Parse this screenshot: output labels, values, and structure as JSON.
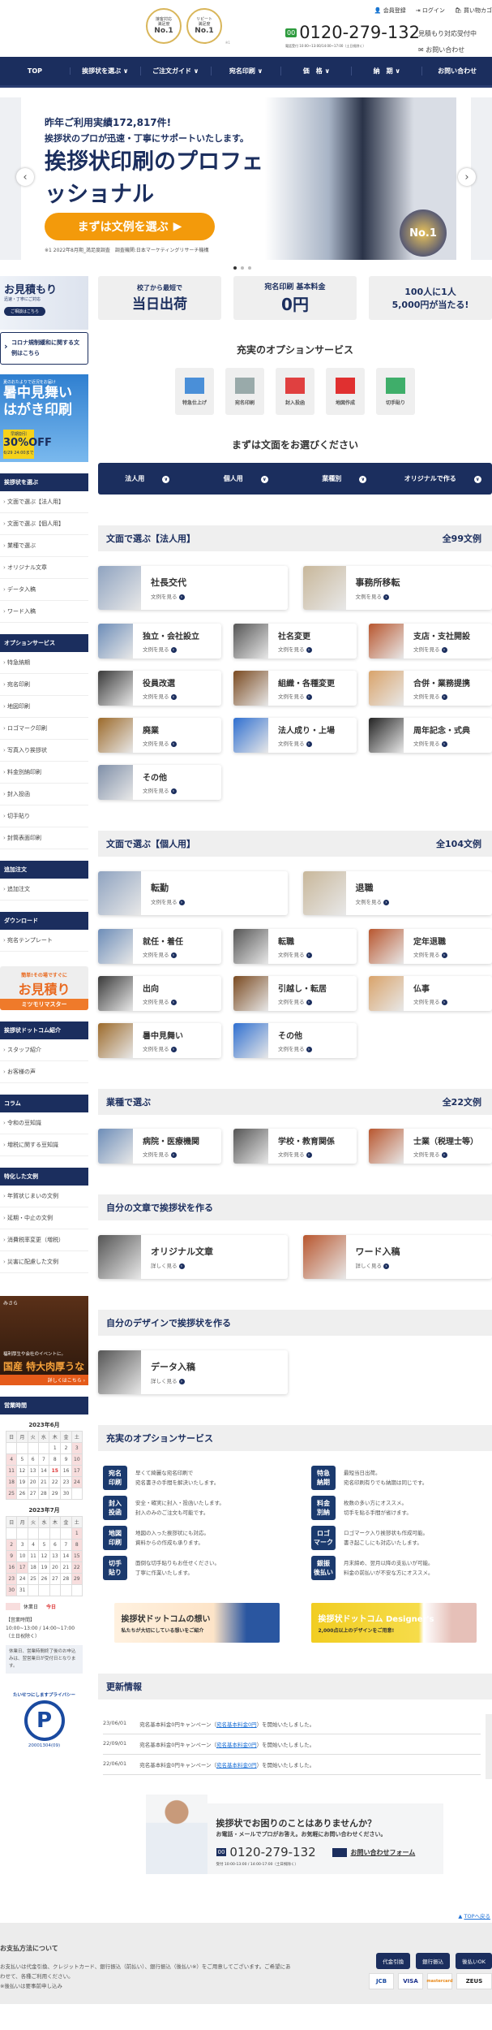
{
  "header": {
    "badges": [
      {
        "top": "接客対応\n満足度",
        "label": "No.1"
      },
      {
        "top": "リピート\n満足度",
        "label": "No.1"
      }
    ],
    "badge_note": "※1",
    "links": [
      "会員登録",
      "ログイン",
      "買い物カゴ"
    ],
    "phone": "0120-279-132",
    "phone_icon": "freedial-icon",
    "phone_hours": "電話受付 10:00~13:00/14:00~17:00（土日祝除く）",
    "estimate": "見積もり対応受付中",
    "contact": "お問い合わせ"
  },
  "nav": [
    "TOP",
    "挨拶状を選ぶ ∨",
    "ご注文ガイド ∨",
    "宛名印刷 ∨",
    "価　格 ∨",
    "納　期 ∨",
    "お問い合わせ"
  ],
  "hero": {
    "line1": "昨年ご利用実績172,817件!",
    "line2": "挨拶状のプロが迅速・丁寧にサポートいたします。",
    "headline": "挨拶状印刷のプロフェッショナル",
    "button": "まずは文例を選ぶ",
    "note": "※1 2022年8月期_満足度調査　調査機関:日本マーケティングリサーチ機構",
    "award": "No.1",
    "slides": 3,
    "active_slide": 1
  },
  "sidebar": {
    "estimate_banner": {
      "title": "お見積もり",
      "sub": "迅速・丁寧にご対応",
      "button": "ご相談はこちら"
    },
    "covid": "コロナ規制緩和に関する文例はこちら",
    "summer": {
      "top": "夏のおたよりで近況をお届け",
      "title": "暑中見舞いはがき印刷",
      "discount_label": "早期割引",
      "discount": "30%OFF",
      "deadline": "6/29 24:00まで"
    },
    "sections": [
      {
        "title": "挨拶状を選ぶ",
        "items": [
          "文面で選ぶ【法人用】",
          "文面で選ぶ【個人用】",
          "業種で選ぶ",
          "オリジナル文章",
          "データ入稿",
          "ワード入稿"
        ]
      },
      {
        "title": "オプションサービス",
        "items": [
          "特急納期",
          "宛名印刷",
          "地図印刷",
          "ロゴマーク印刷",
          "写真入り挨拶状",
          "料金別納印刷",
          "封入投函",
          "切手貼り",
          "封筒表面印刷"
        ]
      },
      {
        "title": "追加注文",
        "items": [
          "追加注文"
        ]
      },
      {
        "title": "ダウンロード",
        "items": [
          "宛名テンプレート"
        ]
      }
    ],
    "mitsumori": {
      "top": "簡単!その場ですぐに",
      "title": "お見積り",
      "name": "ミツモリマスター"
    },
    "sections2": [
      {
        "title": "挨拶状ドットコム紹介",
        "items": [
          "スタッフ紹介",
          "お客様の声"
        ]
      },
      {
        "title": "コラム",
        "items": [
          "令和の豆知識",
          "増税に関する豆知識"
        ]
      },
      {
        "title": "特化した文例",
        "items": [
          "年賀状じまいの文例",
          "延期・中止の文例",
          "消費税率変更（増税）",
          "災害に配慮した文例"
        ]
      }
    ],
    "unagi": {
      "brand": "みさら",
      "line1": "福利厚生や会社のイベントに。",
      "line2": "国産 特大肉厚うなぎ",
      "more": "詳しくはこちら ›"
    },
    "hours_title": "営業時間",
    "weekdays": [
      "日",
      "月",
      "火",
      "水",
      "木",
      "金",
      "土"
    ],
    "calendars": [
      {
        "title": "2023年6月",
        "weeks": [
          [
            "",
            "",
            "",
            "",
            "1",
            "2",
            "3"
          ],
          [
            "4",
            "5",
            "6",
            "7",
            "8",
            "9",
            "10"
          ],
          [
            "11",
            "12",
            "13",
            "14",
            "15",
            "16",
            "17"
          ],
          [
            "18",
            "19",
            "20",
            "21",
            "22",
            "23",
            "24"
          ],
          [
            "25",
            "26",
            "27",
            "28",
            "29",
            "30",
            ""
          ]
        ],
        "holidays": [
          "3",
          "4",
          "10",
          "11",
          "17",
          "18",
          "24",
          "25"
        ],
        "today": "15"
      },
      {
        "title": "2023年7月",
        "weeks": [
          [
            "",
            "",
            "",
            "",
            "",
            "",
            "1"
          ],
          [
            "2",
            "3",
            "4",
            "5",
            "6",
            "7",
            "8"
          ],
          [
            "9",
            "10",
            "11",
            "12",
            "13",
            "14",
            "15"
          ],
          [
            "16",
            "17",
            "18",
            "19",
            "20",
            "21",
            "22"
          ],
          [
            "23",
            "24",
            "25",
            "26",
            "27",
            "28",
            "29"
          ],
          [
            "30",
            "31",
            "",
            "",
            "",
            "",
            ""
          ]
        ],
        "holidays": [
          "1",
          "2",
          "8",
          "9",
          "15",
          "16",
          "17",
          "22",
          "23",
          "29",
          "30"
        ],
        "today": ""
      }
    ],
    "legend_holiday": "休業日",
    "legend_today": "今日",
    "hours_text": "【営業時間】\n10:00~13:00 / 14:00~17:00（土日祝除く）",
    "hours_note": "休業日、営業時間終了後のお申込みは、翌営業日が受付日となります。",
    "privacy": {
      "text": "たいせつにしますプライバシー",
      "number": "20001304(09)"
    }
  },
  "features": [
    {
      "small": "校了から最短で",
      "big": "当日出荷"
    },
    {
      "small": "宛名印刷 基本料金",
      "big": "0円"
    },
    {
      "small": "100人に1人",
      "big": "5,000円が当たる!"
    }
  ],
  "options_title": "充実のオプションサービス",
  "options": [
    {
      "label": "特急仕上げ",
      "icon": "truck-icon",
      "color": "#4a8fd8"
    },
    {
      "label": "宛名印刷",
      "icon": "address-print-icon",
      "color": "#9aa"
    },
    {
      "label": "封入投函",
      "icon": "postbox-icon",
      "color": "#e04040"
    },
    {
      "label": "地図作成",
      "icon": "map-icon",
      "color": "#e03030"
    },
    {
      "label": "切手貼り",
      "icon": "stamp-icon",
      "color": "#3fae6a"
    }
  ],
  "choose_title": "まずは文面をお選びください",
  "tabs": [
    "法人用",
    "個人用",
    "業種別",
    "オリジナルで作る"
  ],
  "view_link": "文例を見る",
  "detail_link": "詳しく見る",
  "corporate": {
    "title": "文面で選ぶ【法人用】",
    "count": "全99文例",
    "big": [
      "社長交代",
      "事務所移転"
    ],
    "items": [
      "独立・会社設立",
      "社名変更",
      "支店・支社開設",
      "役員改選",
      "組織・各種変更",
      "合併・業務提携",
      "廃業",
      "法人成り・上場",
      "周年記念・式典",
      "その他"
    ]
  },
  "personal": {
    "title": "文面で選ぶ【個人用】",
    "count": "全104文例",
    "big": [
      "転勤",
      "退職"
    ],
    "items": [
      "就任・着任",
      "転職",
      "定年退職",
      "出向",
      "引越し・転居",
      "仏事",
      "暑中見舞い",
      "その他"
    ]
  },
  "industry": {
    "title": "業種で選ぶ",
    "count": "全22文例",
    "items": [
      "病院・医療機関",
      "学校・教育関係",
      "士業（税理士等）"
    ]
  },
  "own_text": {
    "title": "自分の文章で挨拶状を作る",
    "items": [
      "オリジナル文章",
      "ワード入稿"
    ]
  },
  "own_design": {
    "title": "自分のデザインで挨拶状を作る",
    "items": [
      "データ入稿"
    ]
  },
  "services": {
    "title": "充実のオプションサービス",
    "items": [
      {
        "tag": "宛名\n印刷",
        "text": "早くて綺麗な宛名印刷で\n宛名書きの手間を解決いたします。"
      },
      {
        "tag": "特急\n納期",
        "text": "最短当日出荷。\n宛名印刷有りでも納期は同じです。"
      },
      {
        "tag": "封入\n投函",
        "text": "安全・確実に封入・投函いたします。\n封入のみのご注文も可能です。"
      },
      {
        "tag": "料金\n別納",
        "text": "枚数の多い方にオススメ。\n切手を貼る手間が省けます。"
      },
      {
        "tag": "地図\n印刷",
        "text": "地図の入った挨拶状にも対応。\n資料からの作成も承ります。"
      },
      {
        "tag": "ロゴ\nマーク",
        "text": "ロゴマーク入り挨拶状も作成可能。\n書き起こしにも対応いたします。"
      },
      {
        "tag": "切手\n貼り",
        "text": "面倒な切手貼りもお任せください。\n丁寧に作業いたします。"
      },
      {
        "tag": "銀振\n後払い",
        "text": "月末締め、翌月以降の支払いが可能。\n料金の前払いが不安な方にオススメ。"
      }
    ]
  },
  "banners": [
    {
      "title": "挨拶状ドットコムの想い",
      "sub": "私たちが大切にしている想いをご紹介"
    },
    {
      "title": "挨拶状ドットコム Designer's",
      "sub": "2,000点以上のデザインをご用意!"
    }
  ],
  "news": {
    "title": "更新情報",
    "rows": [
      {
        "date": "23/06/01",
        "pre": "宛名基本料金0円キャンペーン（",
        "link": "宛名基本料金0円",
        "post": "）を開始いたしました。"
      },
      {
        "date": "22/09/01",
        "pre": "宛名基本料金0円キャンペーン（",
        "link": "宛名基本料金0円",
        "post": "）を開始いたしました。"
      },
      {
        "date": "22/06/01",
        "pre": "宛名基本料金0円キャンペーン（",
        "link": "宛名基本料金0円",
        "post": "）を開始いたしました。"
      }
    ]
  },
  "contact": {
    "question": "挨拶状でお困りのことはありませんか？",
    "sub": "お電話・メールでプロがお答え。お気軽にお問い合わせください。",
    "phone": "0120-279-132",
    "hours": "受付 10:00-13:00 / 14:00-17:00（土日祝除く）",
    "form": "お問い合わせフォーム"
  },
  "to_top": "TOPへ戻る",
  "footer": {
    "title": "お支払方法について",
    "text": "お支払いは代金引換、クレジットカード、銀行振込（前払い）、銀行振込（後払い※）をご用意してございます。ご希望にあわせて、各種ご利用ください。\n※後払いは要事前申し込み",
    "methods": [
      "代金引換",
      "銀行振込",
      "後払いOK"
    ],
    "cards": [
      "JCB",
      "VISA",
      "mastercard",
      "ZEUS"
    ]
  },
  "colors": {
    "navy": "#1b2e5e",
    "orange": "#f39a0b",
    "link": "#1a6fd6",
    "holiday": "#f8dede"
  }
}
